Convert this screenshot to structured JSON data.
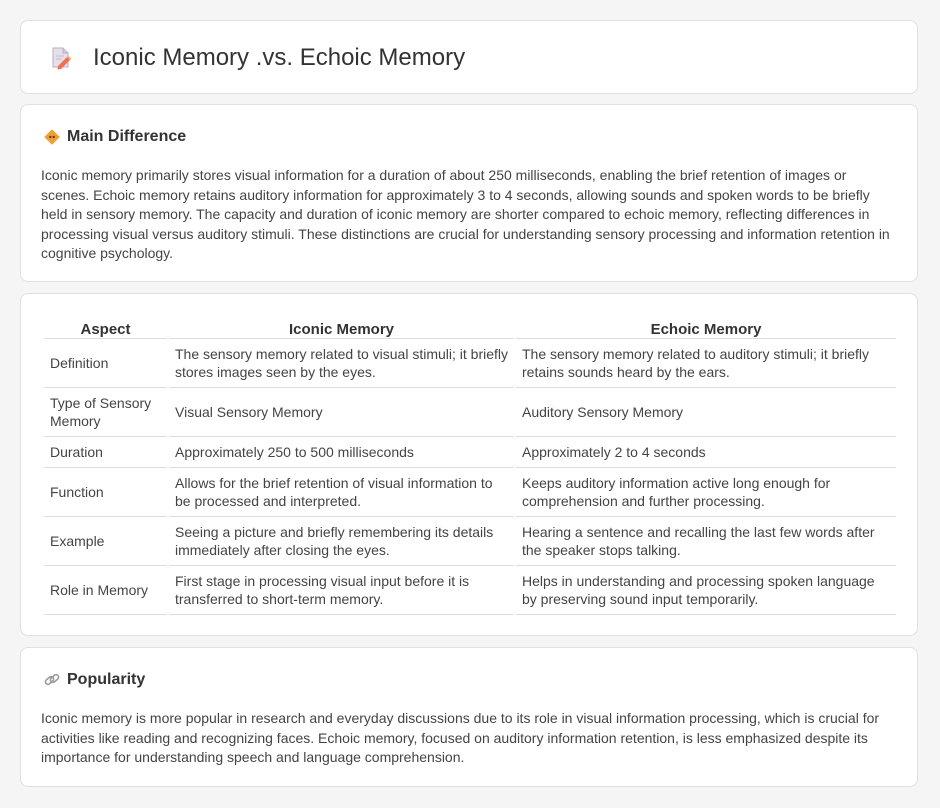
{
  "header": {
    "title": "Iconic Memory .vs. Echoic Memory",
    "icon": "document-pencil-icon"
  },
  "main_difference": {
    "title": "Main Difference",
    "icon": "diamond-icon",
    "text": "Iconic memory primarily stores visual information for a duration of about 250 milliseconds, enabling the brief retention of images or scenes. Echoic memory retains auditory information for approximately 3 to 4 seconds, allowing sounds and spoken words to be briefly held in sensory memory. The capacity and duration of iconic memory are shorter compared to echoic memory, reflecting differences in processing visual versus auditory stimuli. These distinctions are crucial for understanding sensory processing and information retention in cognitive psychology."
  },
  "table": {
    "headers": [
      "Aspect",
      "Iconic Memory",
      "Echoic Memory"
    ],
    "rows": [
      {
        "aspect": "Definition",
        "iconic": "The sensory memory related to visual stimuli; it briefly stores images seen by the eyes.",
        "echoic": "The sensory memory related to auditory stimuli; it briefly retains sounds heard by the ears."
      },
      {
        "aspect": "Type of Sensory Memory",
        "iconic": "Visual Sensory Memory",
        "echoic": "Auditory Sensory Memory"
      },
      {
        "aspect": "Duration",
        "iconic": "Approximately 250 to 500 milliseconds",
        "echoic": "Approximately 2 to 4 seconds"
      },
      {
        "aspect": "Function",
        "iconic": "Allows for the brief retention of visual information to be processed and interpreted.",
        "echoic": "Keeps auditory information active long enough for comprehension and further processing."
      },
      {
        "aspect": "Example",
        "iconic": "Seeing a picture and briefly remembering its details immediately after closing the eyes.",
        "echoic": "Hearing a sentence and recalling the last few words after the speaker stops talking."
      },
      {
        "aspect": "Role in Memory",
        "iconic": "First stage in processing visual input before it is transferred to short-term memory.",
        "echoic": "Helps in understanding and processing spoken language by preserving sound input temporarily."
      }
    ]
  },
  "popularity": {
    "title": "Popularity",
    "icon": "link-icon",
    "text": "Iconic memory is more popular in research and everyday discussions due to its role in visual information processing, which is crucial for activities like reading and recognizing faces. Echoic memory, focused on auditory information retention, is less emphasized despite its importance for understanding speech and language comprehension."
  },
  "colors": {
    "background": "#f5f5f5",
    "card": "#ffffff",
    "border": "#e0e0e0",
    "text": "#333333",
    "accent": "#f0a030"
  }
}
